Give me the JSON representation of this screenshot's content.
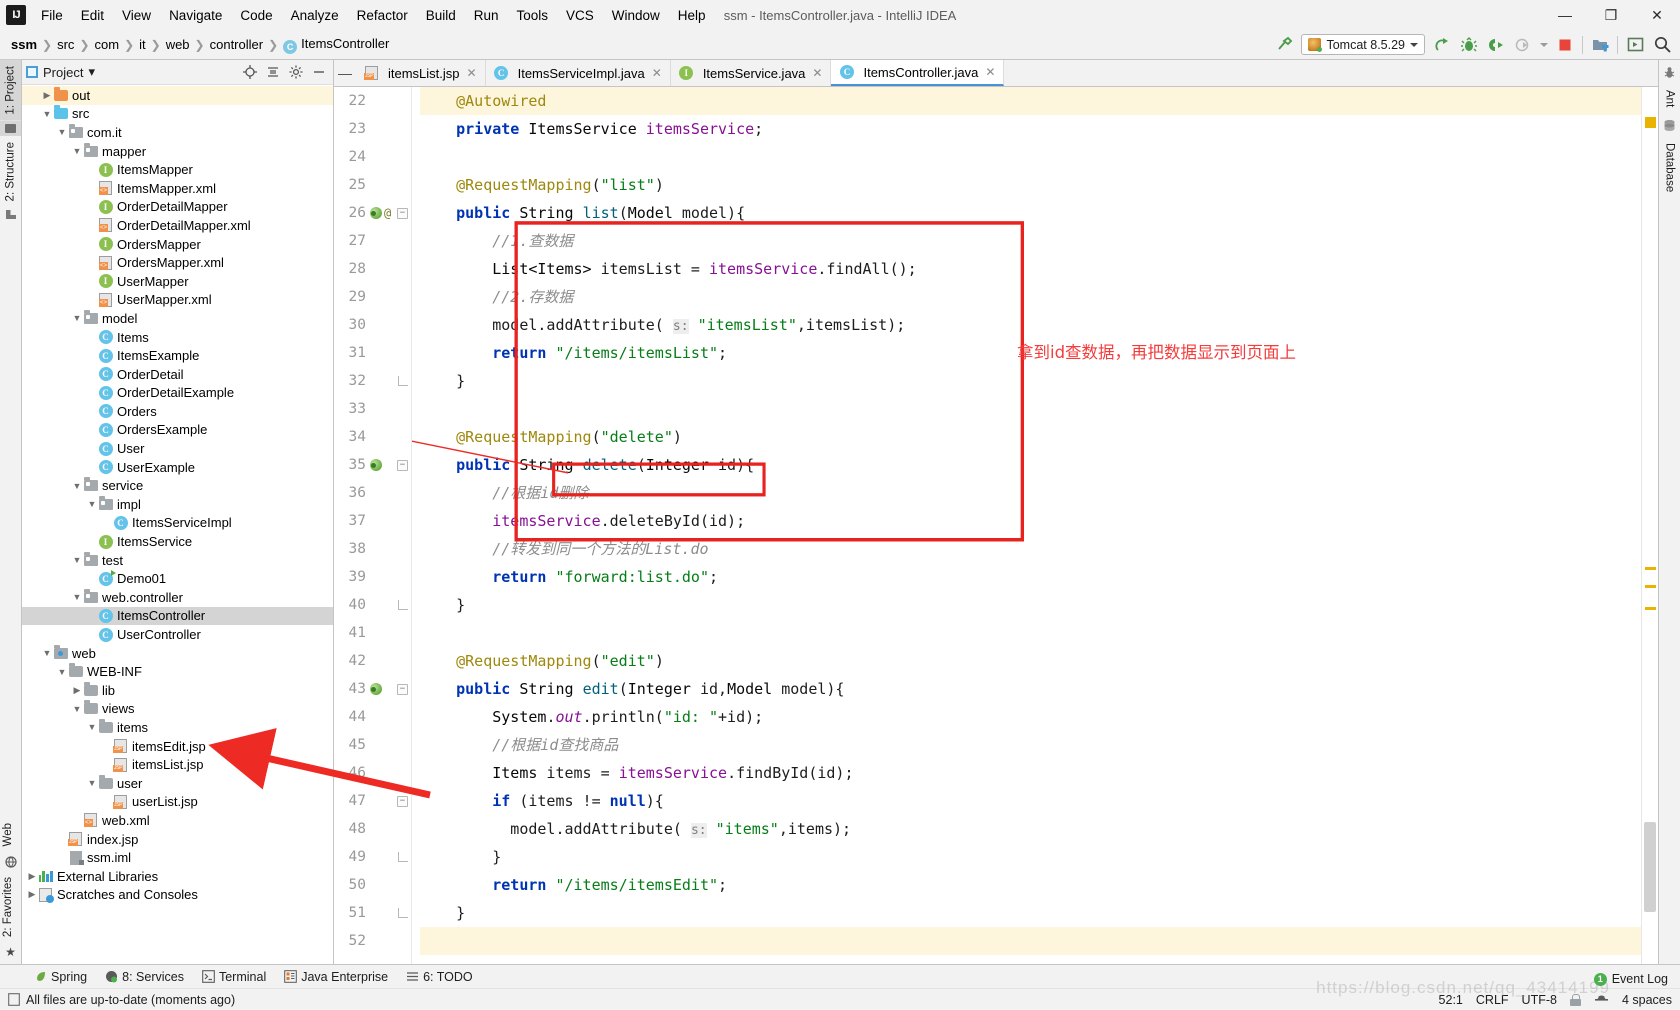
{
  "window": {
    "title": "ssm - ItemsController.java - IntelliJ IDEA",
    "app_logo": "IJ",
    "minimize": "—",
    "maximize": "❐",
    "close": "✕"
  },
  "menubar": {
    "items": [
      {
        "label": "File"
      },
      {
        "label": "Edit"
      },
      {
        "label": "View"
      },
      {
        "label": "Navigate"
      },
      {
        "label": "Code"
      },
      {
        "label": "Analyze"
      },
      {
        "label": "Refactor"
      },
      {
        "label": "Build"
      },
      {
        "label": "Run"
      },
      {
        "label": "Tools"
      },
      {
        "label": "VCS"
      },
      {
        "label": "Window"
      },
      {
        "label": "Help"
      }
    ]
  },
  "navbar": {
    "breadcrumbs": [
      {
        "label": "ssm",
        "bold": true
      },
      {
        "label": "src"
      },
      {
        "label": "com"
      },
      {
        "label": "it"
      },
      {
        "label": "web"
      },
      {
        "label": "controller"
      },
      {
        "label": "ItemsController",
        "icon": "class-icon",
        "icon_letter": "C"
      }
    ],
    "separator": "❯",
    "run_config": "Tomcat 8.5.29",
    "icons": {
      "build": "hammer-icon",
      "run": "run-icon",
      "debug": "debug-icon",
      "run_coverage": "run-with-coverage-icon",
      "profile": "profile-icon",
      "stop": "stop-icon",
      "project_structure": "project-structure-icon",
      "select_target": "select-target-icon",
      "search": "search-everywhere-icon"
    }
  },
  "left_rail": {
    "tabs": [
      {
        "label": "1: Project",
        "active": true,
        "icon": "project-icon"
      },
      {
        "label": "2: Structure",
        "active": false,
        "icon": "structure-icon"
      }
    ],
    "bottom_tabs": [
      {
        "label": "Web",
        "icon": "web-icon"
      },
      {
        "label": "2: Favorites",
        "icon": "favorites-icon"
      }
    ]
  },
  "right_rail": {
    "tabs": [
      {
        "label": "Ant",
        "icon": "ant-icon"
      },
      {
        "label": "Database",
        "icon": "database-icon"
      }
    ]
  },
  "project_panel": {
    "title": "Project",
    "dropdown_caret": "▾",
    "actions": [
      {
        "name": "locate-icon",
        "glyph": "⊕"
      },
      {
        "name": "collapse-all-icon",
        "glyph": "≡"
      },
      {
        "name": "settings-gear-icon",
        "glyph": "⚙"
      },
      {
        "name": "hide-panel-icon",
        "glyph": "—"
      }
    ],
    "tree": [
      {
        "label": "out",
        "indent": 1,
        "twisty": "r",
        "icon": "folder-orange",
        "state": "highlight"
      },
      {
        "label": "src",
        "indent": 1,
        "twisty": "d",
        "icon": "folder-blue"
      },
      {
        "label": "com.it",
        "indent": 2,
        "twisty": "d",
        "icon": "package"
      },
      {
        "label": "mapper",
        "indent": 3,
        "twisty": "d",
        "icon": "package"
      },
      {
        "label": "ItemsMapper",
        "indent": 4,
        "twisty": "",
        "icon": "interface"
      },
      {
        "label": "ItemsMapper.xml",
        "indent": 4,
        "twisty": "",
        "icon": "xml"
      },
      {
        "label": "OrderDetailMapper",
        "indent": 4,
        "twisty": "",
        "icon": "interface"
      },
      {
        "label": "OrderDetailMapper.xml",
        "indent": 4,
        "twisty": "",
        "icon": "xml"
      },
      {
        "label": "OrdersMapper",
        "indent": 4,
        "twisty": "",
        "icon": "interface"
      },
      {
        "label": "OrdersMapper.xml",
        "indent": 4,
        "twisty": "",
        "icon": "xml"
      },
      {
        "label": "UserMapper",
        "indent": 4,
        "twisty": "",
        "icon": "interface"
      },
      {
        "label": "UserMapper.xml",
        "indent": 4,
        "twisty": "",
        "icon": "xml"
      },
      {
        "label": "model",
        "indent": 3,
        "twisty": "d",
        "icon": "package"
      },
      {
        "label": "Items",
        "indent": 4,
        "twisty": "",
        "icon": "class"
      },
      {
        "label": "ItemsExample",
        "indent": 4,
        "twisty": "",
        "icon": "class"
      },
      {
        "label": "OrderDetail",
        "indent": 4,
        "twisty": "",
        "icon": "class"
      },
      {
        "label": "OrderDetailExample",
        "indent": 4,
        "twisty": "",
        "icon": "class"
      },
      {
        "label": "Orders",
        "indent": 4,
        "twisty": "",
        "icon": "class"
      },
      {
        "label": "OrdersExample",
        "indent": 4,
        "twisty": "",
        "icon": "class"
      },
      {
        "label": "User",
        "indent": 4,
        "twisty": "",
        "icon": "class"
      },
      {
        "label": "UserExample",
        "indent": 4,
        "twisty": "",
        "icon": "class"
      },
      {
        "label": "service",
        "indent": 3,
        "twisty": "d",
        "icon": "package"
      },
      {
        "label": "impl",
        "indent": 4,
        "twisty": "d",
        "icon": "package"
      },
      {
        "label": "ItemsServiceImpl",
        "indent": 5,
        "twisty": "",
        "icon": "class"
      },
      {
        "label": "ItemsService",
        "indent": 4,
        "twisty": "",
        "icon": "interface"
      },
      {
        "label": "test",
        "indent": 3,
        "twisty": "d",
        "icon": "package"
      },
      {
        "label": "Demo01",
        "indent": 4,
        "twisty": "",
        "icon": "class-runnable"
      },
      {
        "label": "web.controller",
        "indent": 3,
        "twisty": "d",
        "icon": "package"
      },
      {
        "label": "ItemsController",
        "indent": 4,
        "twisty": "",
        "icon": "class",
        "state": "selected"
      },
      {
        "label": "UserController",
        "indent": 4,
        "twisty": "",
        "icon": "class"
      },
      {
        "label": "web",
        "indent": 1,
        "twisty": "d",
        "icon": "webroot"
      },
      {
        "label": "WEB-INF",
        "indent": 2,
        "twisty": "d",
        "icon": "folder-gray"
      },
      {
        "label": "lib",
        "indent": 3,
        "twisty": "r",
        "icon": "folder-gray"
      },
      {
        "label": "views",
        "indent": 3,
        "twisty": "d",
        "icon": "folder-gray"
      },
      {
        "label": "items",
        "indent": 4,
        "twisty": "d",
        "icon": "folder-gray"
      },
      {
        "label": "itemsEdit.jsp",
        "indent": 5,
        "twisty": "",
        "icon": "jsp"
      },
      {
        "label": "itemsList.jsp",
        "indent": 5,
        "twisty": "",
        "icon": "jsp"
      },
      {
        "label": "user",
        "indent": 4,
        "twisty": "d",
        "icon": "folder-gray"
      },
      {
        "label": "userList.jsp",
        "indent": 5,
        "twisty": "",
        "icon": "jsp"
      },
      {
        "label": "web.xml",
        "indent": 3,
        "twisty": "",
        "icon": "xml"
      },
      {
        "label": "index.jsp",
        "indent": 2,
        "twisty": "",
        "icon": "jsp"
      },
      {
        "label": "ssm.iml",
        "indent": 2,
        "twisty": "",
        "icon": "iml"
      },
      {
        "label": "External Libraries",
        "indent": 0,
        "twisty": "r",
        "icon": "library"
      },
      {
        "label": "Scratches and Consoles",
        "indent": 0,
        "twisty": "r",
        "icon": "scratch"
      }
    ]
  },
  "editor": {
    "tabs": [
      {
        "label": "itemsList.jsp",
        "icon": "jsp",
        "active": false,
        "closable": true
      },
      {
        "label": "ItemsServiceImpl.java",
        "icon": "class",
        "active": false,
        "closable": true
      },
      {
        "label": "ItemsService.java",
        "icon": "interface",
        "active": false,
        "closable": true
      },
      {
        "label": "ItemsController.java",
        "icon": "class",
        "active": true,
        "closable": true
      }
    ],
    "first_line": 22,
    "lines": [
      {
        "n": 22,
        "html": "    <span class='an'>@Autowired</span>",
        "mark": "",
        "fold": "",
        "hl": true
      },
      {
        "n": 23,
        "html": "    <span class='k'>private</span> <span class='tx'>ItemsService</span> <span class='fld'>itemsService</span>;",
        "mark": "",
        "fold": ""
      },
      {
        "n": 24,
        "html": "",
        "mark": "",
        "fold": ""
      },
      {
        "n": 25,
        "html": "    <span class='an'>@RequestMapping</span>(<span class='s'>\"list\"</span>)",
        "mark": "",
        "fold": ""
      },
      {
        "n": 26,
        "html": "    <span class='k'>public</span> <span class='tx'>String</span> <span class='mth'>list</span>(<span class='tx'>Model</span> model){",
        "mark": "bean-at",
        "fold": "open"
      },
      {
        "n": 27,
        "html": "        <span class='cm'>//1.查数据</span>",
        "mark": "",
        "fold": ""
      },
      {
        "n": 28,
        "html": "        <span class='tx'>List&lt;Items&gt;</span> itemsList = <span class='fld'>itemsService</span>.findAll();",
        "mark": "",
        "fold": ""
      },
      {
        "n": 29,
        "html": "        <span class='cm'>//2.存数据</span>",
        "mark": "",
        "fold": ""
      },
      {
        "n": 30,
        "html": "        model.addAttribute( <span class='pn'>s:</span> <span class='s'>\"itemsList\"</span>,itemsList);",
        "mark": "",
        "fold": ""
      },
      {
        "n": 31,
        "html": "        <span class='k'>return</span> <span class='s'>\"/items/itemsList\"</span>;",
        "mark": "",
        "fold": ""
      },
      {
        "n": 32,
        "html": "    }",
        "mark": "",
        "fold": "close"
      },
      {
        "n": 33,
        "html": "",
        "mark": "",
        "fold": ""
      },
      {
        "n": 34,
        "html": "    <span class='an'>@RequestMapping</span>(<span class='s'>\"delete\"</span>)",
        "mark": "",
        "fold": ""
      },
      {
        "n": 35,
        "html": "    <span class='k'>public</span> <span class='tx'>String</span> <span class='mth'>delete</span>(<span class='tx'>Integer</span> id){",
        "mark": "bean",
        "fold": "open"
      },
      {
        "n": 36,
        "html": "        <span class='cm'>//根据id删除</span>",
        "mark": "",
        "fold": ""
      },
      {
        "n": 37,
        "html": "        <span class='fld'>itemsService</span>.deleteById(id);",
        "mark": "",
        "fold": ""
      },
      {
        "n": 38,
        "html": "        <span class='cm'>//转发到同一个方法的List.do</span>",
        "mark": "",
        "fold": ""
      },
      {
        "n": 39,
        "html": "        <span class='k'>return</span> <span class='s'>\"forward:list.do\"</span>;",
        "mark": "",
        "fold": ""
      },
      {
        "n": 40,
        "html": "    }",
        "mark": "",
        "fold": "close"
      },
      {
        "n": 41,
        "html": "",
        "mark": "",
        "fold": ""
      },
      {
        "n": 42,
        "html": "    <span class='an'>@RequestMapping</span>(<span class='s'>\"edit\"</span>)",
        "mark": "",
        "fold": ""
      },
      {
        "n": 43,
        "html": "    <span class='k'>public</span> <span class='tx'>String</span> <span class='mth'>edit</span>(<span class='tx'>Integer</span> id,<span class='tx'>Model</span> model){",
        "mark": "bean",
        "fold": "open"
      },
      {
        "n": 44,
        "html": "        <span class='tx'>System</span>.<span class='fld it'>out</span>.println(<span class='s'>\"id: \"</span>+id);",
        "mark": "",
        "fold": ""
      },
      {
        "n": 45,
        "html": "        <span class='cm'>//根据id查找商品</span>",
        "mark": "",
        "fold": ""
      },
      {
        "n": 46,
        "html": "        <span class='tx'>Items</span> items = <span class='fld'>itemsService</span>.findById(id);",
        "mark": "",
        "fold": ""
      },
      {
        "n": 47,
        "html": "        <span class='k'>if</span> (items != <span class='k'>null</span>){",
        "mark": "",
        "fold": "open"
      },
      {
        "n": 48,
        "html": "          model.addAttribute( <span class='pn'>s:</span> <span class='s'>\"items\"</span>,items);",
        "mark": "",
        "fold": ""
      },
      {
        "n": 49,
        "html": "        }",
        "mark": "",
        "fold": "close"
      },
      {
        "n": 50,
        "html": "        <span class='k'>return</span> <span class='s'>\"/items/itemsEdit\"</span>;",
        "mark": "",
        "fold": ""
      },
      {
        "n": 51,
        "html": "    }",
        "mark": "",
        "fold": "close"
      },
      {
        "n": 52,
        "html": "",
        "mark": "",
        "fold": "",
        "hl": true
      }
    ]
  },
  "annotations": {
    "note_text": "拿到id查数据，再把数据显示到页面上",
    "note_color": "#f43c3c",
    "box_color": "#e8221f",
    "arrow_color": "#ee2a24"
  },
  "tool_windows": {
    "items": [
      {
        "label": "Spring",
        "icon": "spring-leaf-icon"
      },
      {
        "label": "8: Services",
        "icon": "services-icon"
      },
      {
        "label": "Terminal",
        "icon": "terminal-icon"
      },
      {
        "label": "Java Enterprise",
        "icon": "java-enterprise-icon"
      },
      {
        "label": "6: TODO",
        "icon": "todo-icon"
      }
    ]
  },
  "statusbar": {
    "message": "All files are up-to-date (moments ago)",
    "message_icon": "document-icon",
    "event_log": "Event Log",
    "event_log_count": "1",
    "caret_position": "52:1",
    "line_separator": "CRLF",
    "encoding": "UTF-8",
    "lock_icon": "read-only-lock-icon",
    "inspector_icon": "hector-hat-icon",
    "indent": "4 spaces",
    "watermark": "https://blog.csdn.net/qq_43414199"
  }
}
